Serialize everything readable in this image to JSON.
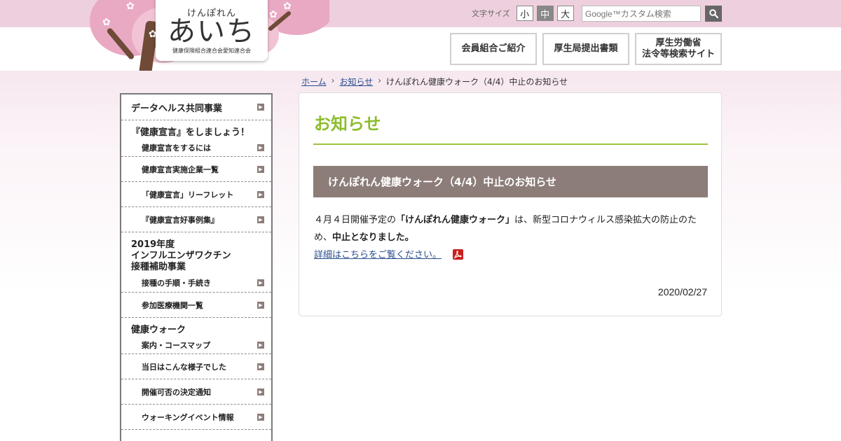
{
  "header": {
    "logo": {
      "kana": "けんぽれん",
      "main": "あいち",
      "sub": "健康保険組合連合会愛知連合会"
    },
    "font_size": {
      "label": "文字サイズ",
      "small": "小",
      "medium": "中",
      "large": "大",
      "selected": "中"
    },
    "search": {
      "placeholder": "Google™カスタム検索",
      "button_icon": "search-icon"
    },
    "nav": [
      {
        "label": "会員組合ご紹介"
      },
      {
        "label": "厚生局提出書類"
      },
      {
        "line1": "厚生労働省",
        "line2": "法令等検索サイト"
      }
    ]
  },
  "breadcrumb": {
    "home": "ホーム",
    "news": "お知らせ",
    "current": "けんぽれん健康ウォーク（4/4）中止のお知らせ"
  },
  "sidebar": {
    "data_health": "データヘルス共同事業",
    "declaration_heading": "『健康宣言』をしましょう！",
    "declaration_items": [
      "健康宣言をするには",
      "健康宣言実施企業一覧",
      "「健康宣言」リーフレット",
      "『健康宣言好事例集』"
    ],
    "flu_heading": [
      "2019年度",
      "インフルエンザワクチン",
      "接種補助事業"
    ],
    "flu_items": [
      "接種の手順・手続き",
      "参加医療機関一覧"
    ],
    "walk_heading": "健康ウォーク",
    "walk_items": [
      "案内・コースマップ",
      "当日はこんな様子でした",
      "開催可否の決定通知",
      "ウォーキングイベント情報"
    ]
  },
  "content": {
    "section_title": "お知らせ",
    "article_title": "けんぽれん健康ウォーク（4/4）中止のお知らせ",
    "body_part1": "４月４日開催予定の",
    "body_bold1": "「けんぽれん健康ウォーク」",
    "body_part2": "は、新型コロナウィルス感染拡大の防止のため、",
    "body_bold2": "中止となりました。",
    "link_text": "詳細はこちらをご覧ください。",
    "link_icon": "pdf-icon",
    "date": "2020/02/27"
  },
  "colors": {
    "accent_green": "#8cbd2c",
    "title_bar": "#8c7d79",
    "top_band_pink": "#eecfdd",
    "link_blue": "#2a4d8f"
  }
}
